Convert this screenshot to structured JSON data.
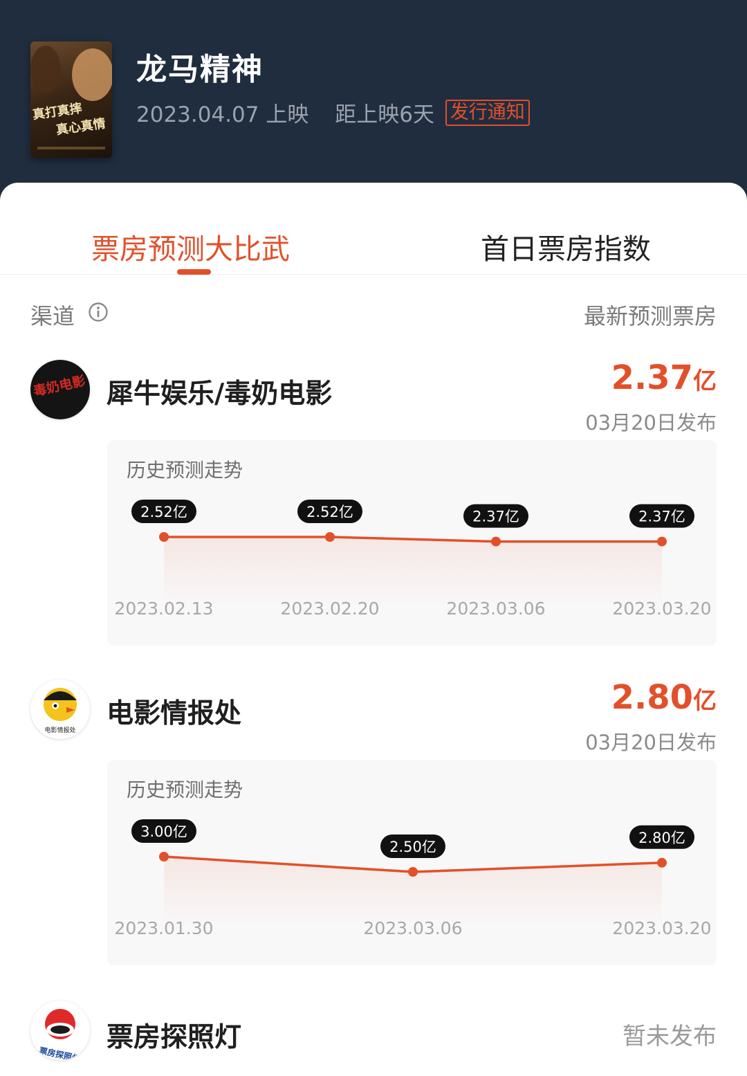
{
  "movie": {
    "title": "龙马精神",
    "release": "2023.04.07 上映",
    "countdown": "距上映6天",
    "notice_tag": "发行通知",
    "poster_text_1": "真打真摔",
    "poster_text_2": "真心真情"
  },
  "tabs": [
    {
      "label": "票房预测大比武",
      "active": true
    },
    {
      "label": "首日票房指数",
      "active": false
    }
  ],
  "list_header": {
    "left": "渠道",
    "right": "最新预测票房"
  },
  "channels": [
    {
      "name": "犀牛娱乐/毒奶电影",
      "value": "2.37",
      "unit": "亿",
      "date": "03月20日发布",
      "logo_text": "毒奶电影",
      "trend": {
        "title": "历史预测走势",
        "chart_data": {
          "type": "line",
          "x": [
            "2023.02.13",
            "2023.02.20",
            "2023.03.06",
            "2023.03.20"
          ],
          "values": [
            2.52,
            2.52,
            2.37,
            2.37
          ],
          "data_labels": [
            "2.52亿",
            "2.52亿",
            "2.37亿",
            "2.37亿"
          ],
          "grid": false,
          "color": "#e2502a"
        }
      }
    },
    {
      "name": "电影情报处",
      "value": "2.80",
      "unit": "亿",
      "date": "03月20日发布",
      "logo_text": "电影情报处",
      "trend": {
        "title": "历史预测走势",
        "chart_data": {
          "type": "line",
          "x": [
            "2023.01.30",
            "2023.03.06",
            "2023.03.20"
          ],
          "values": [
            3.0,
            2.5,
            2.8
          ],
          "data_labels": [
            "3.00亿",
            "2.50亿",
            "2.80亿"
          ],
          "grid": false,
          "color": "#e2502a"
        }
      }
    },
    {
      "name": "票房探照灯",
      "status": "暂未发布",
      "logo_text": "票房探照灯"
    }
  ],
  "colors": {
    "accent": "#e2502a",
    "header_bg": "#202d3f"
  }
}
